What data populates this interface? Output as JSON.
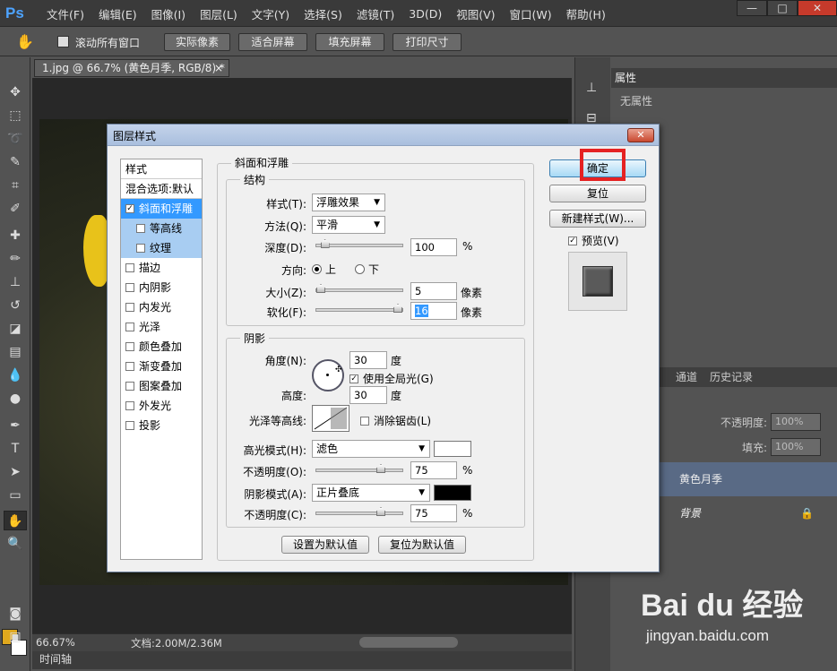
{
  "app": {
    "logo": "Ps"
  },
  "menu": [
    "文件(F)",
    "编辑(E)",
    "图像(I)",
    "图层(L)",
    "文字(Y)",
    "选择(S)",
    "滤镜(T)",
    "3D(D)",
    "视图(V)",
    "窗口(W)",
    "帮助(H)"
  ],
  "window_controls": {
    "minimize": "—",
    "restore": "□",
    "close": "✕"
  },
  "options": {
    "scroll_all": "滚动所有窗口",
    "actual_pixels": "实际像素",
    "fit_screen": "适合屏幕",
    "fill_screen": "填充屏幕",
    "print_size": "打印尺寸"
  },
  "document": {
    "tab": "1.jpg @ 66.7% (黄色月季, RGB/8) *",
    "close": "×"
  },
  "status": {
    "zoom": "66.67%",
    "doc_info": "文档:2.00M/2.36M"
  },
  "timeline": "时间轴",
  "properties": {
    "tab": "属性",
    "none": "无属性"
  },
  "layers_panel": {
    "tabs": [
      "通道",
      "历史记录"
    ],
    "opacity_label": "不透明度:",
    "opacity_value": "100%",
    "fill_label": "填充:",
    "fill_value": "100%",
    "layers": [
      {
        "name": "黄色月季",
        "selected": true
      },
      {
        "name": "背景",
        "selected": false
      }
    ]
  },
  "watermark": {
    "logo": "Bai du 经验",
    "url": "jingyan.baidu.com"
  },
  "dialog": {
    "title": "图层样式",
    "close": "✕",
    "style_list": {
      "header": "样式",
      "blend": "混合选项:默认",
      "items": [
        {
          "label": "斜面和浮雕",
          "checked": true,
          "selected": true,
          "sub": false
        },
        {
          "label": "等高线",
          "checked": false,
          "selected": false,
          "sub": true
        },
        {
          "label": "纹理",
          "checked": false,
          "selected": false,
          "sub": true
        },
        {
          "label": "描边",
          "checked": false,
          "selected": false,
          "sub": false
        },
        {
          "label": "内阴影",
          "checked": false,
          "selected": false,
          "sub": false
        },
        {
          "label": "内发光",
          "checked": false,
          "selected": false,
          "sub": false
        },
        {
          "label": "光泽",
          "checked": false,
          "selected": false,
          "sub": false
        },
        {
          "label": "颜色叠加",
          "checked": false,
          "selected": false,
          "sub": false
        },
        {
          "label": "渐变叠加",
          "checked": false,
          "selected": false,
          "sub": false
        },
        {
          "label": "图案叠加",
          "checked": false,
          "selected": false,
          "sub": false
        },
        {
          "label": "外发光",
          "checked": false,
          "selected": false,
          "sub": false
        },
        {
          "label": "投影",
          "checked": false,
          "selected": false,
          "sub": false
        }
      ]
    },
    "section_title": "斜面和浮雕",
    "structure": {
      "title": "结构",
      "style_label": "样式(T):",
      "style_value": "浮雕效果",
      "method_label": "方法(Q):",
      "method_value": "平滑",
      "depth_label": "深度(D):",
      "depth_value": "100",
      "depth_unit": "%",
      "depth_pct": 0.1,
      "direction_label": "方向:",
      "dir_up": "上",
      "dir_down": "下",
      "size_label": "大小(Z):",
      "size_value": "5",
      "size_unit": "像素",
      "size_pct": 0.02,
      "soften_label": "软化(F):",
      "soften_value": "16",
      "soften_unit": "像素",
      "soften_pct": 1.0
    },
    "shading": {
      "title": "阴影",
      "angle_label": "角度(N):",
      "angle_value": "30",
      "angle_unit": "度",
      "global_light": "使用全局光(G)",
      "altitude_label": "高度:",
      "altitude_value": "30",
      "altitude_unit": "度",
      "gloss_label": "光泽等高线:",
      "antialias": "消除锯齿(L)",
      "highlight_label": "高光模式(H):",
      "highlight_value": "滤色",
      "highlight_color": "#ffffff",
      "hl_opacity_label": "不透明度(O):",
      "hl_opacity_value": "75",
      "hl_opacity_unit": "%",
      "hl_opacity_pct": 0.75,
      "shadow_label": "阴影模式(A):",
      "shadow_value": "正片叠底",
      "shadow_color": "#000000",
      "sh_opacity_label": "不透明度(C):",
      "sh_opacity_value": "75",
      "sh_opacity_unit": "%",
      "sh_opacity_pct": 0.75
    },
    "make_default": "设置为默认值",
    "reset_default": "复位为默认值",
    "ok": "确定",
    "reset": "复位",
    "new_style": "新建样式(W)...",
    "preview": "预览(V)"
  }
}
